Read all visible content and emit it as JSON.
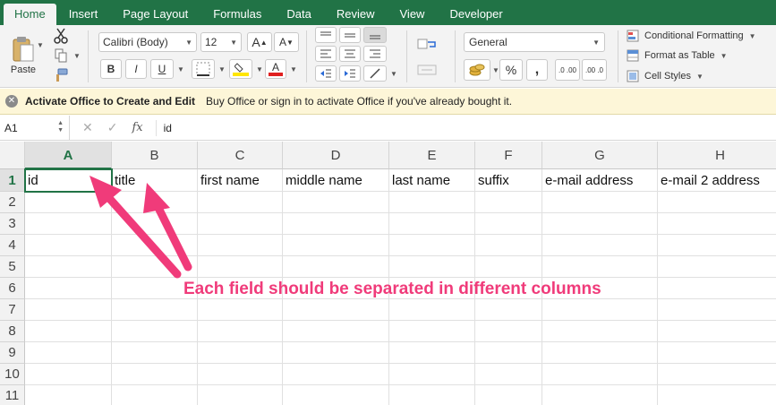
{
  "tabs": [
    "Home",
    "Insert",
    "Page Layout",
    "Formulas",
    "Data",
    "Review",
    "View",
    "Developer"
  ],
  "ribbon": {
    "paste_label": "Paste",
    "font_name": "Calibri (Body)",
    "font_size": "12",
    "number_format": "General",
    "conditional_formatting": "Conditional Formatting",
    "format_as_table": "Format as Table",
    "cell_styles": "Cell Styles",
    "bold": "B",
    "italic": "I",
    "underline": "U",
    "grow_font": "A",
    "shrink_font": "A",
    "font_color_letter": "A",
    "percent": "%",
    "comma": ",",
    "inc_decimal": ".0 .00",
    "dec_decimal": ".00 .0",
    "accent_color": "#217346",
    "highlight_color": "#ffe600",
    "font_color": "#e02020"
  },
  "infobar": {
    "title": "Activate Office to Create and Edit",
    "message": "Buy Office or sign in to activate Office if you've already bought it."
  },
  "formula_bar": {
    "cell_ref": "A1",
    "fx": "fx",
    "value": "id"
  },
  "sheet": {
    "columns": [
      "A",
      "B",
      "C",
      "D",
      "E",
      "F",
      "G",
      "H"
    ],
    "rows": [
      "1",
      "2",
      "3",
      "4",
      "5",
      "6",
      "7",
      "8",
      "9",
      "10",
      "11"
    ],
    "row1": [
      "id",
      "title",
      "first name",
      "middle name",
      "last name",
      "suffix",
      "e-mail address",
      "e-mail 2 address"
    ]
  },
  "annotation": {
    "text": "Each field should be separated in different columns",
    "color": "#f03b7a"
  }
}
